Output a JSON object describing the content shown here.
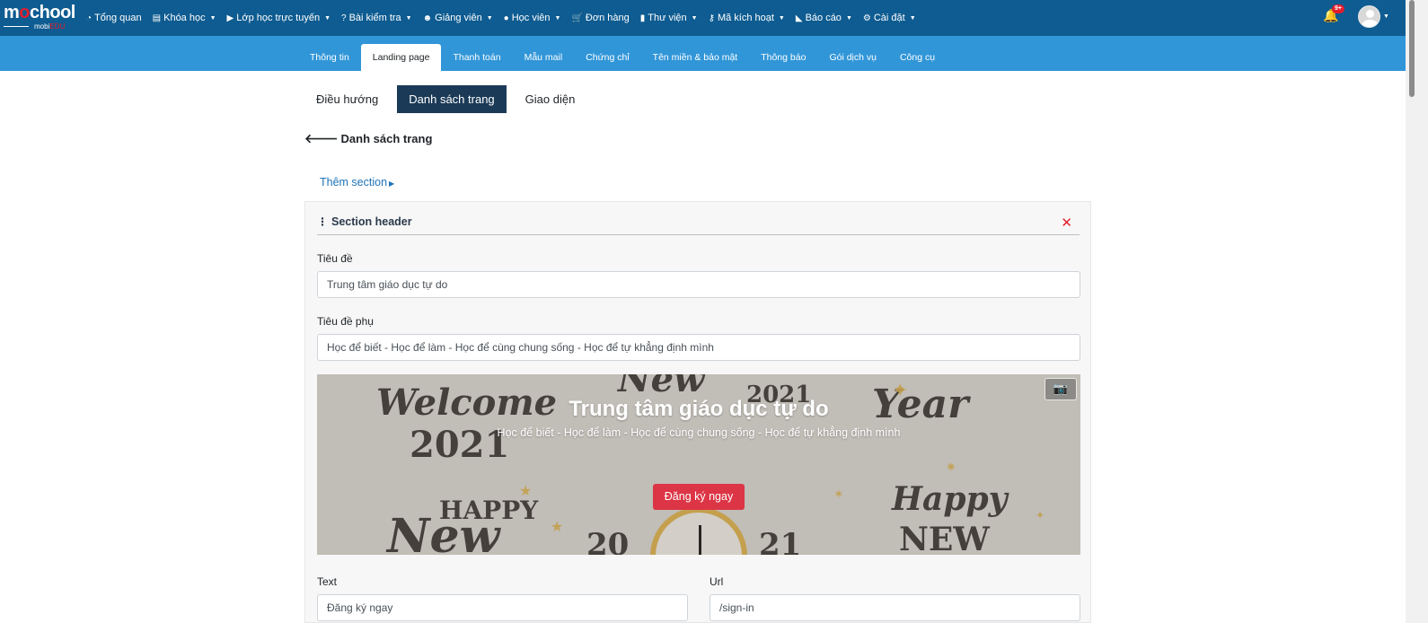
{
  "logo": {
    "text_m": "m",
    "text_o": "o",
    "text_rest": "chool",
    "sub_a": "mobi",
    "sub_b": "EDU"
  },
  "topnav": {
    "items": [
      {
        "icon": "dashboard-icon",
        "glyph": "◔",
        "label": "Tổng quan",
        "caret": false
      },
      {
        "icon": "list-icon",
        "glyph": "▤",
        "label": "Khóa học",
        "caret": true
      },
      {
        "icon": "video-icon",
        "glyph": "▶",
        "label": "Lớp học trực tuyến",
        "caret": true
      },
      {
        "icon": "question-icon",
        "glyph": "?",
        "label": "Bài kiểm tra",
        "caret": true
      },
      {
        "icon": "users-icon",
        "glyph": "☻",
        "label": "Giảng viên",
        "caret": true
      },
      {
        "icon": "user-icon",
        "glyph": "●",
        "label": "Học viên",
        "caret": true
      },
      {
        "icon": "cart-icon",
        "glyph": "🛒",
        "label": "Đơn hàng",
        "caret": false
      },
      {
        "icon": "book-icon",
        "glyph": "▮",
        "label": "Thư viện",
        "caret": true
      },
      {
        "icon": "key-icon",
        "glyph": "⚷",
        "label": "Mã kích hoạt",
        "caret": true
      },
      {
        "icon": "chart-icon",
        "glyph": "◣",
        "label": "Báo cáo",
        "caret": true
      },
      {
        "icon": "gears-icon",
        "glyph": "⚙",
        "label": "Cài đặt",
        "caret": true
      }
    ],
    "notification_badge": "9+"
  },
  "subnav": {
    "tabs": [
      "Thông tin",
      "Landing page",
      "Thanh toán",
      "Mẫu mail",
      "Chứng chỉ",
      "Tên miền & bảo mật",
      "Thông báo",
      "Gói dịch vụ",
      "Công cụ"
    ],
    "active_index": 1
  },
  "pills": {
    "items": [
      "Điều hướng",
      "Danh sách trang",
      "Giao diện"
    ],
    "active_index": 1
  },
  "back_link": "Danh sách trang",
  "add_section": "Thêm section",
  "section": {
    "title": "Section header",
    "title_label": "Tiêu đề",
    "title_value": "Trung tâm giáo dục tự do",
    "subtitle_label": "Tiêu đề phụ",
    "subtitle_value": "Học để biết - Học để làm - Học để cùng chung sống - Học để tự khẳng định mình",
    "banner": {
      "heading": "Trung tâm giáo dục tự do",
      "subheading": "Học để biết - Học để làm - Học để cùng chung sống - Học để tự khẳng định mình",
      "button": "Đăng ký ngay",
      "background_words": [
        "Welcome",
        "2021",
        "New",
        "2021",
        "Year",
        "HAPPY",
        "New",
        "20",
        "21",
        "Happy",
        "NEW"
      ]
    },
    "text_label": "Text",
    "text_value": "Đăng ký ngay",
    "url_label": "Url",
    "url_value": "/sign-in"
  },
  "colors": {
    "navbar": "#0e5c91",
    "subnav": "#3196d8",
    "pill_active": "#1b3a57",
    "danger": "#dc3545",
    "link": "#1f73b7"
  }
}
